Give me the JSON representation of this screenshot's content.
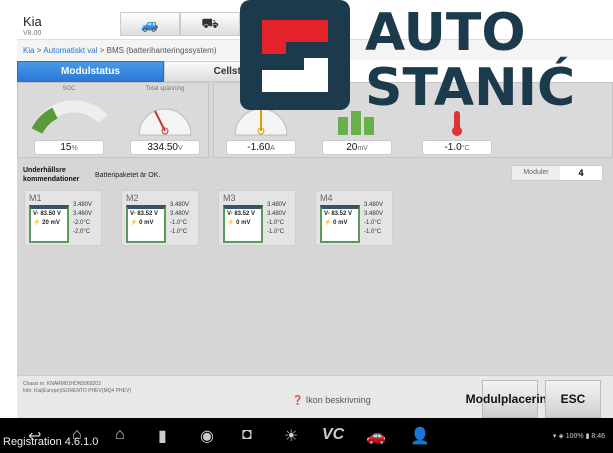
{
  "header": {
    "title": "Kia",
    "version": "V8.00"
  },
  "breadcrumb": {
    "link1": "Kia",
    "link2": "Automatiskt val",
    "current": "BMS (batterihanteringssystem)",
    "sep": " > "
  },
  "tabs": [
    "Modulstatus",
    "Cellstatus"
  ],
  "gauges": [
    {
      "label": "SOC",
      "value": "15",
      "unit": "%",
      "fraction": 0.15
    },
    {
      "label": "Total spänning",
      "value": "334.50",
      "unit": "V"
    },
    {
      "label": "",
      "value": "-1.60",
      "unit": "A"
    },
    {
      "label": "",
      "value": "20",
      "unit": "mV"
    },
    {
      "label": "",
      "value": "-1.0",
      "unit": "°C"
    }
  ],
  "recommendations": {
    "heading": "Underhållsre kommendationer",
    "message": "Batteripaketet är OK.",
    "modules_label": "Moduler",
    "modules_value": "4"
  },
  "modules": [
    {
      "name": "M1",
      "voltage": "83.50",
      "diff": "20",
      "unit_v": "V",
      "unit_mv": "mV",
      "stats": [
        "3.480V",
        "3.460V",
        "-2.0°C",
        "-2.0°C"
      ]
    },
    {
      "name": "M2",
      "voltage": "83.52",
      "diff": "0",
      "unit_v": "V",
      "unit_mv": "mV",
      "stats": [
        "3.480V",
        "3.480V",
        "-1.0°C",
        "-1.0°C"
      ]
    },
    {
      "name": "M3",
      "voltage": "83.52",
      "diff": "0",
      "unit_v": "V",
      "unit_mv": "mV",
      "stats": [
        "3.480V",
        "3.480V",
        "-1.0°C",
        "-1.0°C"
      ]
    },
    {
      "name": "M4",
      "voltage": "83.52",
      "diff": "0",
      "unit_v": "V",
      "unit_mv": "mV",
      "stats": [
        "3.480V",
        "3.480V",
        "-1.0°C",
        "-1.0°C"
      ]
    }
  ],
  "footer": {
    "chassis": "Chassi nr: KNARM81HDN5068203",
    "info": "Info: Kia(Europe)/SORENTO PHEV(MQ4 PHEV)",
    "ikon": "Ikon beskrivning",
    "btn_module": "Modulplacering",
    "btn_esc": "ESC"
  },
  "statusbar": {
    "battery": "100%",
    "time": "8:46"
  },
  "overlay": {
    "registration": "Registration 4.6.1.0",
    "logo": "AUTO STANIĆ"
  },
  "colors": {
    "accent": "#2a78d8",
    "logo_dark": "#1b3a4b",
    "logo_red": "#e5232b"
  }
}
